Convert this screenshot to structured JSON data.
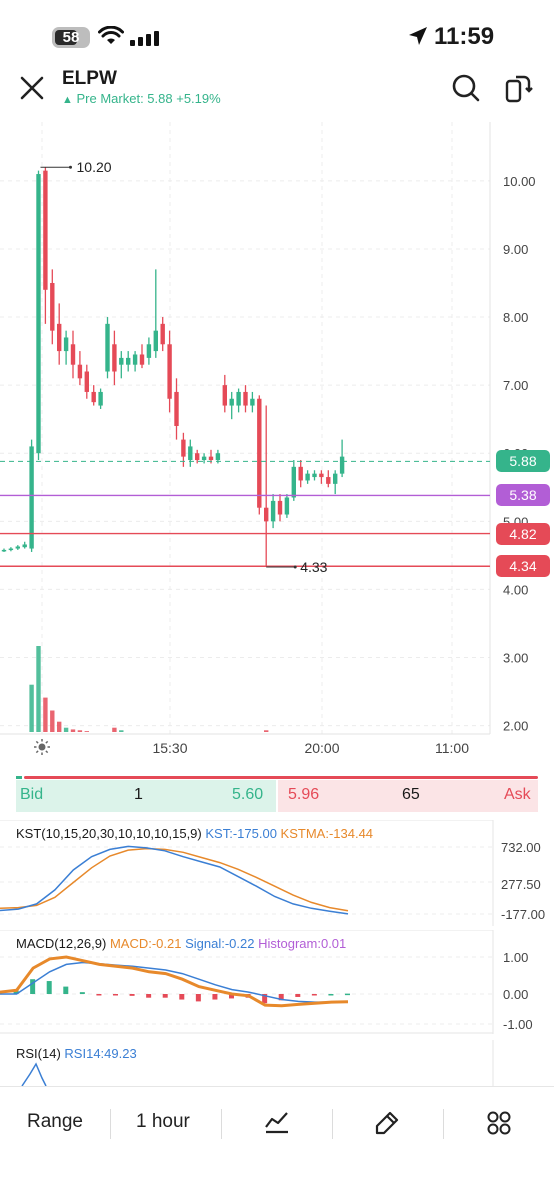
{
  "status_bar": {
    "battery": "58",
    "time": "11:59"
  },
  "header": {
    "ticker": "ELPW",
    "premarket_label": "Pre Market: 5.88 +5.19%",
    "premarket_arrow": "▲"
  },
  "colors": {
    "up": "#35b48b",
    "down": "#e54a57",
    "purple": "#b25ed6",
    "blue": "#3b7fd4",
    "orange": "#e7892b"
  },
  "chart_data": {
    "type": "candlestick",
    "y_ticks": [
      "10.00",
      "9.00",
      "8.00",
      "7.00",
      "6.00",
      "5.00",
      "4.00",
      "3.00",
      "2.00"
    ],
    "y_tick_values": [
      10,
      9,
      8,
      7,
      6,
      5,
      4,
      3,
      2
    ],
    "ylim": [
      1.95,
      10.6
    ],
    "x_ticks": [
      "15:30",
      "20:00",
      "11:00"
    ],
    "session_icon": "sun-icon",
    "high_label": "10.20",
    "low_label": "4.33",
    "high_value": 10.2,
    "low_value": 4.33,
    "price_tags": [
      {
        "label": "5.88",
        "value": 5.88,
        "color": "#35b48b"
      },
      {
        "label": "5.38",
        "value": 5.38,
        "color": "#b25ed6"
      },
      {
        "label": "4.82",
        "value": 4.82,
        "color": "#e54a57"
      },
      {
        "label": "4.34",
        "value": 4.34,
        "color": "#e54a57"
      }
    ],
    "candles": [
      {
        "o": 4.57,
        "h": 4.6,
        "l": 4.55,
        "c": 4.58
      },
      {
        "o": 4.58,
        "h": 4.62,
        "l": 4.56,
        "c": 4.6
      },
      {
        "o": 4.6,
        "h": 4.65,
        "l": 4.58,
        "c": 4.63
      },
      {
        "o": 4.62,
        "h": 4.7,
        "l": 4.6,
        "c": 4.66
      },
      {
        "o": 4.6,
        "h": 6.2,
        "l": 4.55,
        "c": 6.1
      },
      {
        "o": 6.0,
        "h": 10.15,
        "l": 5.9,
        "c": 10.1
      },
      {
        "o": 10.15,
        "h": 10.2,
        "l": 7.9,
        "c": 8.4
      },
      {
        "o": 8.5,
        "h": 8.7,
        "l": 7.6,
        "c": 7.8
      },
      {
        "o": 7.9,
        "h": 8.2,
        "l": 7.3,
        "c": 7.5
      },
      {
        "o": 7.5,
        "h": 7.8,
        "l": 7.3,
        "c": 7.7
      },
      {
        "o": 7.6,
        "h": 7.8,
        "l": 7.1,
        "c": 7.3
      },
      {
        "o": 7.3,
        "h": 7.5,
        "l": 7.0,
        "c": 7.1
      },
      {
        "o": 7.2,
        "h": 7.3,
        "l": 6.8,
        "c": 6.9
      },
      {
        "o": 6.9,
        "h": 7.0,
        "l": 6.7,
        "c": 6.75
      },
      {
        "o": 6.7,
        "h": 6.95,
        "l": 6.65,
        "c": 6.9
      },
      {
        "o": 7.2,
        "h": 8.0,
        "l": 7.1,
        "c": 7.9
      },
      {
        "o": 7.6,
        "h": 7.8,
        "l": 7.0,
        "c": 7.2
      },
      {
        "o": 7.3,
        "h": 7.5,
        "l": 7.1,
        "c": 7.4
      },
      {
        "o": 7.3,
        "h": 7.5,
        "l": 7.2,
        "c": 7.4
      },
      {
        "o": 7.3,
        "h": 7.5,
        "l": 7.2,
        "c": 7.45
      },
      {
        "o": 7.45,
        "h": 7.6,
        "l": 7.25,
        "c": 7.3
      },
      {
        "o": 7.4,
        "h": 7.7,
        "l": 7.3,
        "c": 7.6
      },
      {
        "o": 7.5,
        "h": 8.7,
        "l": 7.4,
        "c": 7.8
      },
      {
        "o": 7.9,
        "h": 8.0,
        "l": 7.5,
        "c": 7.6
      },
      {
        "o": 7.6,
        "h": 7.8,
        "l": 6.6,
        "c": 6.8
      },
      {
        "o": 6.9,
        "h": 7.1,
        "l": 6.2,
        "c": 6.4
      },
      {
        "o": 6.2,
        "h": 6.3,
        "l": 5.8,
        "c": 5.95
      },
      {
        "o": 5.9,
        "h": 6.2,
        "l": 5.8,
        "c": 6.1
      },
      {
        "o": 6.0,
        "h": 6.05,
        "l": 5.85,
        "c": 5.9
      },
      {
        "o": 5.9,
        "h": 6.0,
        "l": 5.85,
        "c": 5.95
      },
      {
        "o": 5.95,
        "h": 6.05,
        "l": 5.85,
        "c": 5.9
      },
      {
        "o": 5.9,
        "h": 6.05,
        "l": 5.85,
        "c": 6.0
      },
      {
        "o": 7.0,
        "h": 7.15,
        "l": 6.6,
        "c": 6.7
      },
      {
        "o": 6.7,
        "h": 6.9,
        "l": 6.5,
        "c": 6.8
      },
      {
        "o": 6.7,
        "h": 6.95,
        "l": 6.6,
        "c": 6.9
      },
      {
        "o": 6.9,
        "h": 7.0,
        "l": 6.6,
        "c": 6.7
      },
      {
        "o": 6.7,
        "h": 6.9,
        "l": 6.6,
        "c": 6.8
      },
      {
        "o": 6.8,
        "h": 6.85,
        "l": 5.1,
        "c": 5.2
      },
      {
        "o": 5.2,
        "h": 6.7,
        "l": 4.33,
        "c": 5.0
      },
      {
        "o": 5.0,
        "h": 5.4,
        "l": 4.9,
        "c": 5.3
      },
      {
        "o": 5.3,
        "h": 5.4,
        "l": 5.0,
        "c": 5.1
      },
      {
        "o": 5.1,
        "h": 5.4,
        "l": 5.05,
        "c": 5.35
      },
      {
        "o": 5.35,
        "h": 5.9,
        "l": 5.3,
        "c": 5.8
      },
      {
        "o": 5.8,
        "h": 5.9,
        "l": 5.5,
        "c": 5.6
      },
      {
        "o": 5.6,
        "h": 5.75,
        "l": 5.55,
        "c": 5.7
      },
      {
        "o": 5.65,
        "h": 5.75,
        "l": 5.6,
        "c": 5.7
      },
      {
        "o": 5.7,
        "h": 5.75,
        "l": 5.55,
        "c": 5.65
      },
      {
        "o": 5.65,
        "h": 5.75,
        "l": 5.5,
        "c": 5.55
      },
      {
        "o": 5.55,
        "h": 5.75,
        "l": 5.4,
        "c": 5.7
      },
      {
        "o": 5.7,
        "h": 6.2,
        "l": 5.65,
        "c": 5.95
      }
    ],
    "volumes": [
      0,
      0,
      0,
      0,
      0.55,
      1.0,
      0.4,
      0.25,
      0.12,
      0.05,
      0.03,
      0.02,
      0.01,
      0,
      0,
      0,
      0.05,
      0.02,
      0,
      0,
      0,
      0,
      0,
      0,
      0,
      0,
      0,
      0,
      0,
      0,
      0,
      0,
      0,
      0,
      0,
      0,
      0,
      0,
      0.02,
      0,
      0,
      0,
      0,
      0,
      0,
      0,
      0,
      0,
      0,
      0
    ]
  },
  "bid_ask": {
    "bid_label": "Bid",
    "bid_size": "1",
    "bid_price": "5.60",
    "ask_price": "5.96",
    "ask_size": "65",
    "ask_label": "Ask"
  },
  "kst": {
    "title": "KST(10,15,20,30,10,10,10,15,9)",
    "kst_label": "KST:-175.00",
    "kstma_label": "KSTMA:-134.44",
    "ticks": [
      "732.00",
      "277.50",
      "-177.00"
    ],
    "kst_values": [
      -130,
      -110,
      -40,
      150,
      420,
      600,
      700,
      740,
      720,
      680,
      600,
      530,
      460,
      330,
      200,
      60,
      -40,
      -100,
      -140,
      -175
    ],
    "kstma_values": [
      -100,
      -90,
      -60,
      50,
      250,
      450,
      610,
      690,
      710,
      700,
      660,
      590,
      520,
      430,
      320,
      200,
      80,
      -20,
      -90,
      -134
    ]
  },
  "macd": {
    "title": "MACD(12,26,9)",
    "macd_label": "MACD:-0.21",
    "signal_label": "Signal:-0.22",
    "hist_label": "Histogram:0.01",
    "ticks": [
      "1.00",
      "0.00",
      "-1.00"
    ],
    "macd_values": [
      0.05,
      0.1,
      0.7,
      0.95,
      1.0,
      0.9,
      0.8,
      0.75,
      0.7,
      0.6,
      0.55,
      0.4,
      0.2,
      0.1,
      0.0,
      -0.05,
      -0.3,
      -0.32,
      -0.28,
      -0.25,
      -0.22,
      -0.21
    ],
    "signal_values": [
      0.0,
      0.0,
      0.3,
      0.6,
      0.8,
      0.85,
      0.82,
      0.78,
      0.75,
      0.7,
      0.65,
      0.55,
      0.4,
      0.25,
      0.12,
      0.05,
      -0.05,
      -0.15,
      -0.2,
      -0.22,
      -0.22,
      -0.22
    ],
    "histogram": [
      0.05,
      0.1,
      0.4,
      0.35,
      0.2,
      0.05,
      -0.02,
      -0.03,
      -0.05,
      -0.1,
      -0.1,
      -0.15,
      -0.2,
      -0.15,
      -0.12,
      -0.1,
      -0.25,
      -0.17,
      -0.08,
      -0.03,
      0.0,
      0.01
    ]
  },
  "rsi": {
    "title": "RSI(14)",
    "rsi_label": "RSI14:49.23"
  },
  "toolbar": {
    "range_label": "Range",
    "interval_label": "1 hour"
  }
}
